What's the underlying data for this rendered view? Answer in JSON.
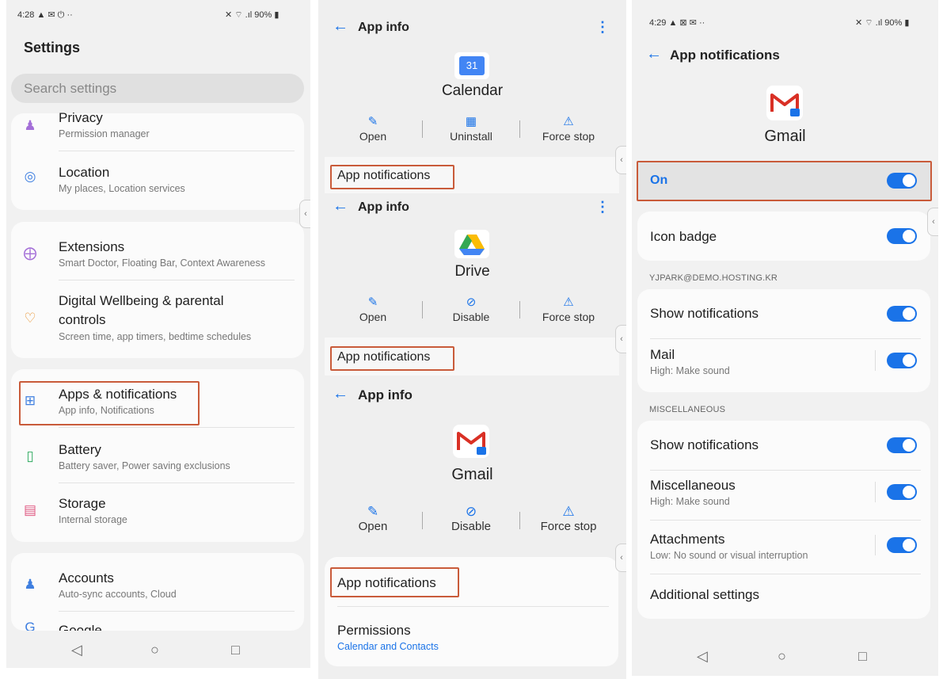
{
  "panel1": {
    "status_time": "4:28 ▲ ✉ ⏻ ··",
    "status_right": "✕ ⌔ .ıl 90% ▮",
    "title": "Settings",
    "search_placeholder": "Search settings",
    "items": [
      {
        "title": "Privacy",
        "subtitle": "Permission manager",
        "icon": "privacy-icon"
      },
      {
        "title": "Location",
        "subtitle": "My places, Location services",
        "icon": "location-icon"
      },
      {
        "title": "Extensions",
        "subtitle": "Smart Doctor, Floating Bar, Context Awareness",
        "icon": "extensions-icon"
      },
      {
        "title": "Digital Wellbeing & parental",
        "title2": "controls",
        "subtitle": "Screen time, app timers, bedtime schedules",
        "icon": "wellbeing-icon"
      },
      {
        "title": "Apps & notifications",
        "subtitle": "App info, Notifications",
        "icon": "apps-icon"
      },
      {
        "title": "Battery",
        "subtitle": "Battery saver, Power saving exclusions",
        "icon": "battery-icon"
      },
      {
        "title": "Storage",
        "subtitle": "Internal storage",
        "icon": "storage-icon"
      },
      {
        "title": "Accounts",
        "subtitle": "Auto-sync accounts, Cloud",
        "icon": "accounts-icon"
      },
      {
        "title": "Google",
        "subtitle": "",
        "icon": "google-icon"
      }
    ]
  },
  "panel2": {
    "header_title": "App info",
    "apps": [
      {
        "name": "Calendar",
        "badge": "31",
        "actions": [
          "Open",
          "Uninstall",
          "Force stop"
        ]
      },
      {
        "name": "Drive",
        "actions": [
          "Open",
          "Disable",
          "Force stop"
        ]
      },
      {
        "name": "Gmail",
        "actions": [
          "Open",
          "Disable",
          "Force stop"
        ]
      }
    ],
    "app_notifications": "App notifications",
    "permissions_title": "Permissions",
    "permissions_sub": "Calendar and Contacts"
  },
  "panel3": {
    "status_time": "4:29 ▲ ⊠ ✉ ··",
    "status_right": "✕ ⌔ .ıl 90% ▮",
    "title": "App notifications",
    "app_name": "Gmail",
    "on_label": "On",
    "icon_badge": "Icon badge",
    "account_label": "YJPARK@DEMO.HOSTING.KR",
    "show_notifications": "Show notifications",
    "mail_title": "Mail",
    "mail_sub": "High: Make sound",
    "misc_label": "MISCELLANEOUS",
    "show_notifications2": "Show notifications",
    "misc_title": "Miscellaneous",
    "misc_sub": "High: Make sound",
    "attach_title": "Attachments",
    "attach_sub": "Low: No sound or visual interruption",
    "additional": "Additional settings"
  },
  "colors": {
    "accent": "#1a73e8",
    "highlight": "#c95b3a",
    "icon_purple": "#a46fd8",
    "icon_orange": "#e8912d",
    "icon_blue": "#3f7fe0",
    "icon_green": "#2eaa5f",
    "icon_pink": "#e05a83"
  }
}
